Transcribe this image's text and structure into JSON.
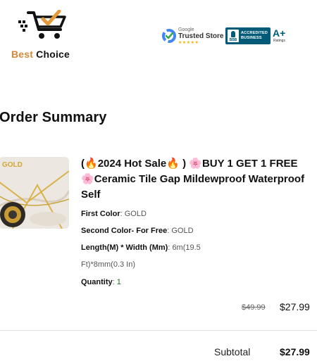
{
  "header": {
    "brand": {
      "best": "Best",
      "choice": "Choice"
    },
    "trust_badge": {
      "provider": "Google",
      "label": "Trusted Store",
      "stars": "★★★★★"
    },
    "bbb_badge": {
      "seal": "BBB",
      "line1": "ACCREDITED",
      "line2": "BUSINESS",
      "grade": "A+",
      "grade_label": "Ratings"
    }
  },
  "order_summary": {
    "title": "Order Summary",
    "item": {
      "thumbnail_label": "GOLD",
      "title_parts": {
        "open": "(",
        "fire1": "🔥",
        "sale": "2024 Hot Sale",
        "fire2": "🔥",
        "close": ")",
        "flower1": "🌸",
        "promo": "BUY 1 GET 1 FREE",
        "flower2": "🌸",
        "name": "Ceramic Tile Gap Mildewproof Waterproof Self"
      },
      "attributes": {
        "first_color_label": "First Color",
        "first_color_value": "GOLD",
        "second_color_label": "Second Color- For Free",
        "second_color_value": "GOLD",
        "size_label": "Length(M)  * Width (Mm)",
        "size_value_1": "6m(19.5",
        "size_value_2": "Ft)*8mm(0.3 In)",
        "quantity_label": "Quantity",
        "quantity_value": "1"
      },
      "price_original": "$49.99",
      "price_current": "$27.99"
    },
    "subtotal_label": "Subtotal",
    "subtotal_value": "$27.99"
  }
}
